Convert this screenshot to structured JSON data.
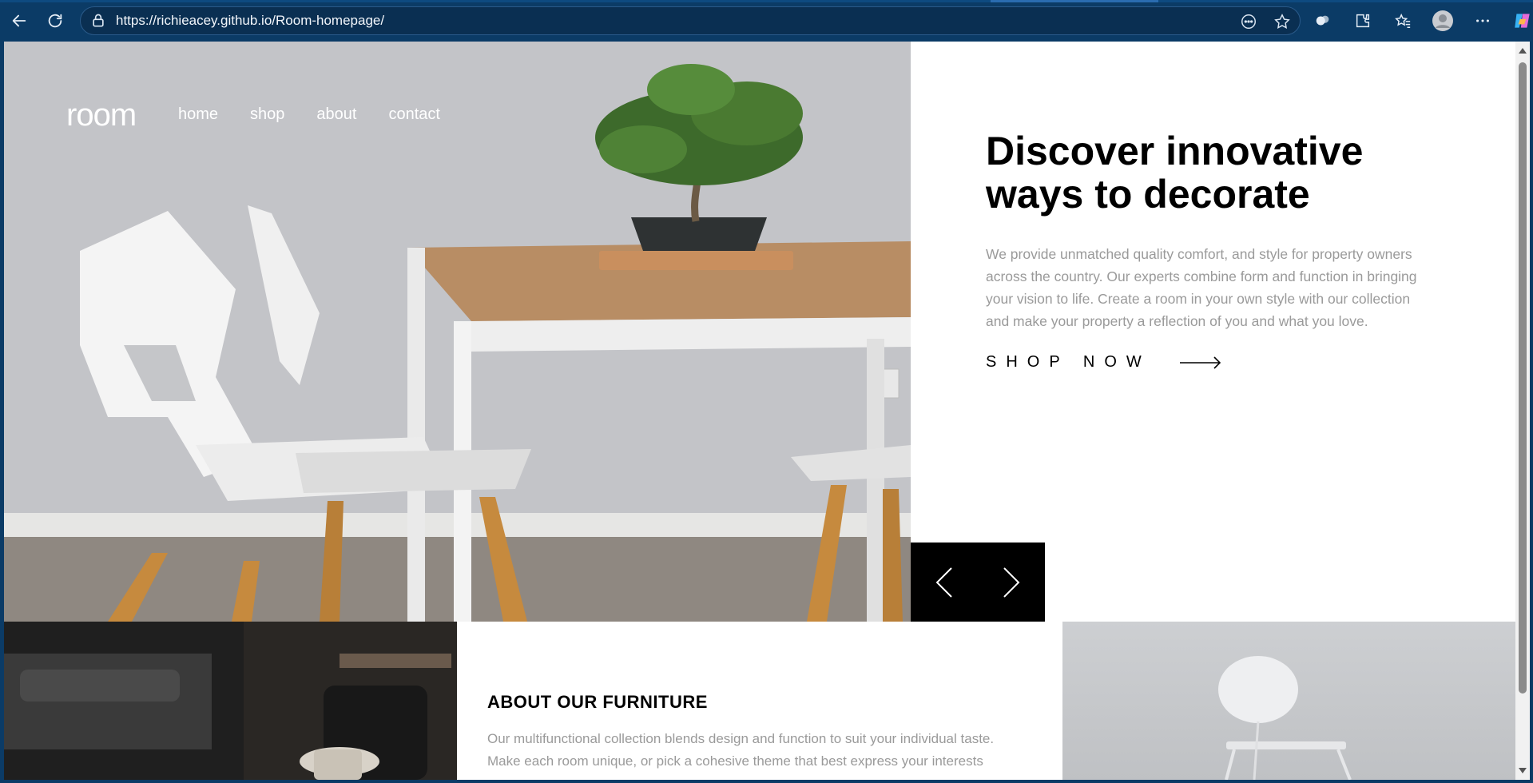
{
  "browser": {
    "url": "https://richieacey.github.io/Room-homepage/",
    "icons": [
      "back-arrow-icon",
      "refresh-icon",
      "lock-icon",
      "reader-mode-icon",
      "favorite-star-icon",
      "copilot-shield-icon",
      "extensions-icon",
      "favorites-icon",
      "profile-avatar-icon",
      "more-menu-icon",
      "copilot-icon"
    ]
  },
  "site": {
    "logo": "room",
    "nav": [
      {
        "label": "home"
      },
      {
        "label": "shop"
      },
      {
        "label": "about"
      },
      {
        "label": "contact"
      }
    ],
    "hero": {
      "title": "Discover innovative ways to decorate",
      "description": "We provide unmatched quality comfort, and style for property owners across the country. Our experts combine form and function in bringing your vision to life. Create a room in your own style with our collection and make your property a reflection of you and what you love.",
      "cta": "SHOP NOW"
    },
    "about": {
      "title": "ABOUT OUR FURNITURE",
      "text": "Our multifunctional collection blends design and function to suit your individual taste. Make each room unique, or pick a cohesive theme that best express your interests"
    }
  },
  "colors": {
    "browser_frame": "#0b3b66",
    "hero_title": "#000000",
    "body_text": "#9a9a9a",
    "slider_bg": "#000000"
  }
}
